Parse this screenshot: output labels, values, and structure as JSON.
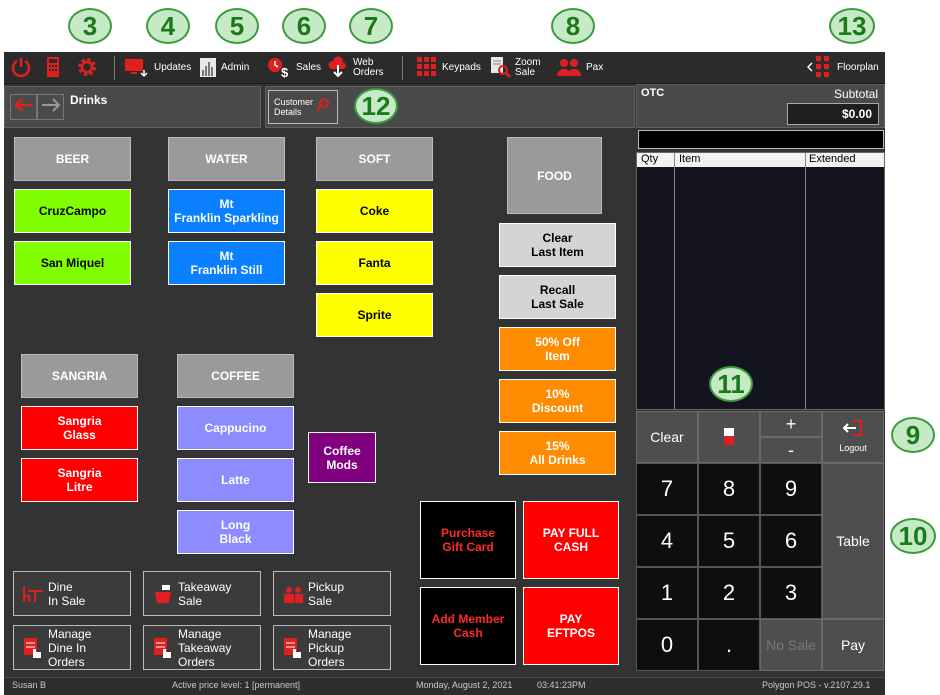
{
  "callouts": [
    "3",
    "4",
    "5",
    "6",
    "7",
    "8",
    "13",
    "12",
    "11",
    "9",
    "10"
  ],
  "toolbar": {
    "updates": "Updates",
    "admin": "Admin",
    "sales": "Sales",
    "web_orders": "Web\nOrders",
    "keypads": "Keypads",
    "zoom_sale": "Zoom\nSale",
    "pax": "Pax",
    "floorplan": "Floorplan"
  },
  "nav": {
    "title": "Drinks"
  },
  "customer_details": "Customer\nDetails",
  "order": {
    "title": "OTC",
    "subtotal_label": "Subtotal",
    "subtotal_value": "$0.00",
    "columns": [
      "Qty",
      "Item",
      "Extended"
    ]
  },
  "categories": {
    "beer": "BEER",
    "water": "WATER",
    "soft": "SOFT",
    "food": "FOOD",
    "sangria": "SANGRIA",
    "coffee": "COFFEE"
  },
  "items": {
    "cruzcampo": "CruzCampo",
    "san_miquel": "San Miquel",
    "mt_sparkling": "Mt\nFranklin Sparkling",
    "mt_still": "Mt\nFranklin Still",
    "coke": "Coke",
    "fanta": "Fanta",
    "sprite": "Sprite",
    "sangria_glass": "Sangria\nGlass",
    "sangria_litre": "Sangria\nLitre",
    "cappucino": "Cappucino",
    "latte": "Latte",
    "long_black": "Long\nBlack",
    "coffee_mods": "Coffee\nMods"
  },
  "functions": {
    "clear_last": "Clear\nLast Item",
    "recall_last": "Recall\nLast Sale",
    "off50": "50% Off\nItem",
    "discount10": "10%\nDiscount",
    "drinks15": "15%\nAll Drinks"
  },
  "payments": {
    "gift_card": "Purchase\nGift Card",
    "pay_full_cash": "PAY FULL\nCASH",
    "add_member_cash": "Add Member\nCash",
    "pay_eftpos": "PAY\nEFTPOS"
  },
  "modes": {
    "dine_in": "Dine\nIn Sale",
    "takeaway": "Takeaway\nSale",
    "pickup": "Pickup\nSale",
    "manage_dine": "Manage\nDine In\nOrders",
    "manage_takeaway": "Manage\nTakeaway\nOrders",
    "manage_pickup": "Manage\nPickup\nOrders"
  },
  "keypad": {
    "clear": "Clear",
    "plus": "+",
    "minus": "-",
    "logout": "Logout",
    "table": "Table",
    "no_sale": "No Sale",
    "pay": "Pay",
    "digits": [
      "7",
      "8",
      "9",
      "4",
      "5",
      "6",
      "1",
      "2",
      "3",
      "0",
      "."
    ]
  },
  "status": {
    "user": "Susan B",
    "price_level": "Active price level: 1 [permanent]",
    "date": "Monday, August  2, 2021",
    "time": "03:41:23PM",
    "version": "Polygon POS - v.2107.29.1"
  },
  "colors": {
    "accent_red": "#e02020",
    "background": "#333333"
  }
}
